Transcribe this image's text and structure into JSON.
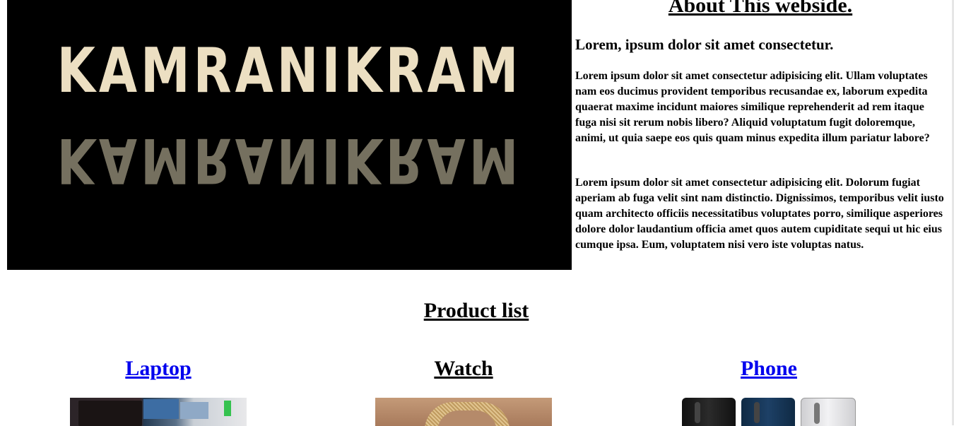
{
  "hero": {
    "logo_text": "KAMRANIKRAM",
    "logo_reflection": "KAMRANIKRAM"
  },
  "about": {
    "title": "About This webside.",
    "subtitle": "Lorem, ipsum dolor sit amet consectetur.",
    "paragraph1": "Lorem ipsum dolor sit amet consectetur adipisicing elit. Ullam voluptates nam eos ducimus provident temporibus recusandae ex, laborum expedita quaerat maxime incidunt maiores similique reprehenderit ad rem itaque fuga nisi sit rerum nobis libero? Aliquid voluptatum fugit doloremque, animi, ut quia saepe eos quis quam minus expedita illum pariatur labore?",
    "paragraph2": "Lorem ipsum dolor sit amet consectetur adipisicing elit. Dolorum fugiat aperiam ab fuga velit sint nam distinctio. Dignissimos, temporibus velit iusto quam architecto officiis necessitatibus voluptates porro, similique asperiores dolore dolor laudantium officia amet quos autem cupiditate sequi ut hic eius cumque ipsa. Eum, voluptatem nisi vero iste voluptas natus."
  },
  "products": {
    "title": "Product list",
    "items": [
      {
        "label": "Laptop",
        "link_color": "#0000ee"
      },
      {
        "label": "Watch",
        "link_color": "#000000"
      },
      {
        "label": "Phone",
        "link_color": "#0000ee"
      }
    ]
  }
}
